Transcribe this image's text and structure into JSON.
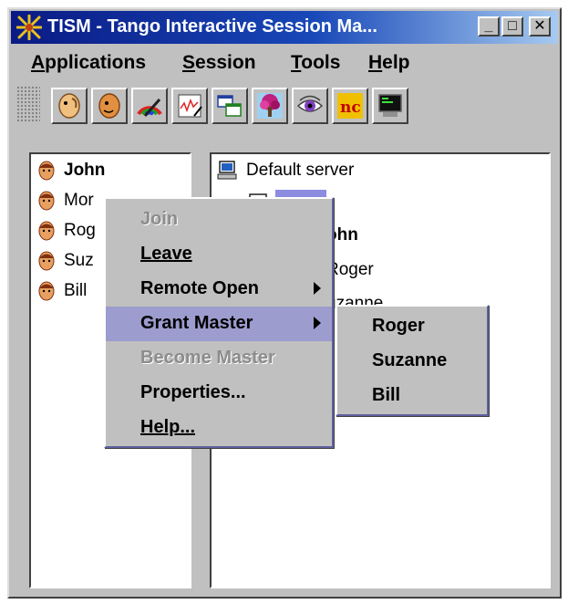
{
  "window": {
    "title": "TISM - Tango Interactive Session Ma...",
    "minimize": "_",
    "maximize": "□",
    "close": "✕"
  },
  "menubar": {
    "applications": {
      "mnemonic": "A",
      "rest": "pplications"
    },
    "session": {
      "mnemonic": "S",
      "rest": "ession"
    },
    "tools": {
      "mnemonic": "T",
      "rest": "ools"
    },
    "help": {
      "mnemonic": "H",
      "rest": "elp"
    }
  },
  "toolbar": {
    "buttons": [
      "face-profile-icon",
      "face-talk-icon",
      "paint-palette-icon",
      "whiteboard-chart-icon",
      "windows-share-icon",
      "tree-image-icon",
      "eye-icon",
      "nc-logo-icon",
      "terminal-icon"
    ]
  },
  "users": [
    {
      "name": "John",
      "bold": true
    },
    {
      "name": "Mor",
      "bold": false
    },
    {
      "name": "Rog",
      "bold": false
    },
    {
      "name": "Suz",
      "bold": false
    },
    {
      "name": "Bill",
      "bold": false
    }
  ],
  "tree": {
    "server": "Default server",
    "members": [
      "ohn",
      "Roger",
      "uzanne"
    ]
  },
  "context_menu": {
    "items": [
      {
        "label": "Join",
        "enabled": false
      },
      {
        "label": "Leave",
        "enabled": true
      },
      {
        "label": "Remote Open",
        "enabled": true,
        "submenu": true
      },
      {
        "label": "Grant Master",
        "enabled": true,
        "submenu": true,
        "active": true
      },
      {
        "label": "Become Master",
        "enabled": false
      },
      {
        "label": "Properties...",
        "enabled": true
      },
      {
        "label": "Help...",
        "enabled": true
      }
    ]
  },
  "submenu": {
    "items": [
      "Roger",
      "Suzanne",
      "Bill"
    ]
  },
  "colors": {
    "title_start": "#0a1a84",
    "title_end": "#a6caf0",
    "highlight": "#9c9cce",
    "window_bg": "#c0c0c0"
  }
}
